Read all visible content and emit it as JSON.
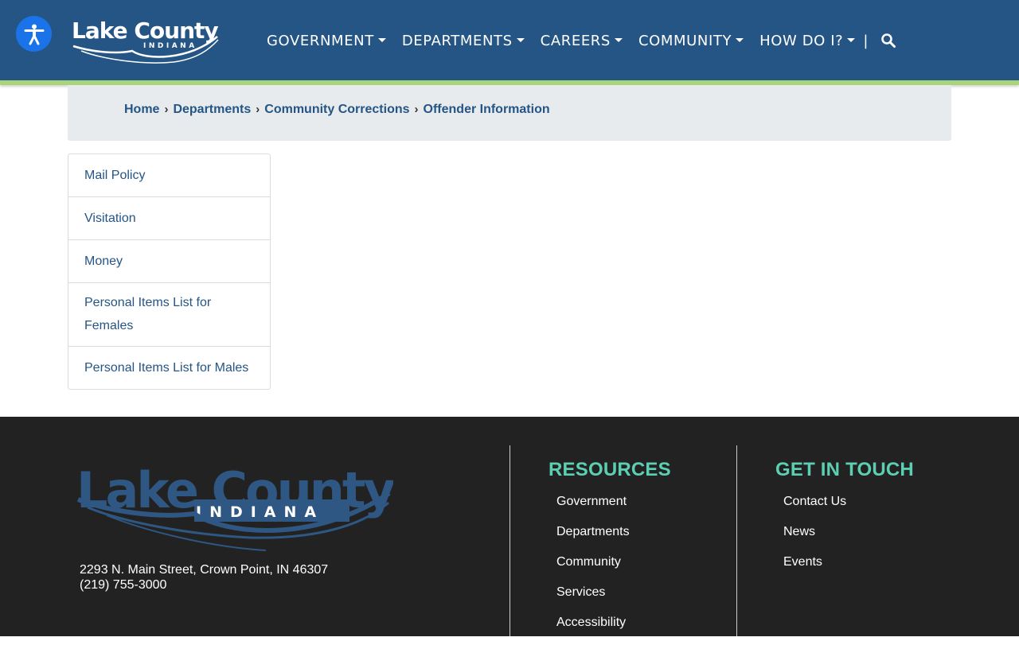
{
  "header": {
    "logo_text": "Lake County",
    "logo_subtext": "INDIANA",
    "nav": [
      {
        "label": "GOVERNMENT"
      },
      {
        "label": "DEPARTMENTS"
      },
      {
        "label": "CAREERS"
      },
      {
        "label": "COMMUNITY"
      },
      {
        "label": "HOW DO I?"
      }
    ],
    "divider": "|"
  },
  "breadcrumb": [
    {
      "label": "Home"
    },
    {
      "label": "Departments"
    },
    {
      "label": "Community Corrections"
    },
    {
      "label": "Offender Information"
    }
  ],
  "sidebar": {
    "items": [
      {
        "label": "Mail Policy"
      },
      {
        "label": "Visitation"
      },
      {
        "label": "Money"
      },
      {
        "label": "Personal Items List for Females"
      },
      {
        "label": "Personal Items List for Males"
      }
    ]
  },
  "footer": {
    "logo_text": "Lake County",
    "logo_subtext": "INDIANA",
    "address": "2293 N. Main Street, Crown Point, IN 46307",
    "phone": "(219) 755-3000",
    "resources": {
      "heading": "RESOURCES",
      "links": [
        "Government",
        "Departments",
        "Community",
        "Services",
        "Accessibility"
      ]
    },
    "contact": {
      "heading": "GET IN TOUCH",
      "links": [
        "Contact Us",
        "News",
        "Events"
      ]
    }
  },
  "colors": {
    "header_bg": "#245585",
    "accent_green": "#a9d57a",
    "accessibility_blue": "#1a73e8",
    "link_blue": "#245585",
    "footer_bg": "#222222",
    "footer_heading": "#5ccfb3",
    "footer_logo": "#2f5783"
  },
  "icons": {
    "accessibility": "accessibility-person-icon",
    "search": "search-icon",
    "breadcrumb_separator": "chevron-right-icon",
    "dropdown": "caret-down-icon"
  }
}
